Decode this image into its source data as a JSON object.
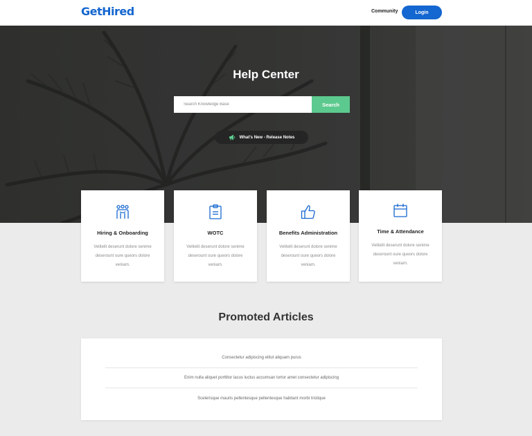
{
  "header": {
    "logo": "GetHired",
    "nav_community": "Community",
    "login_label": "Login"
  },
  "hero": {
    "title": "Help Center",
    "search_placeholder": "Search Knowledge Base",
    "search_button": "Search",
    "release_notes": "What's New - Release Notes",
    "release_icon": "megaphone-icon"
  },
  "categories": [
    {
      "title": "Hiring & Onboarding",
      "description": "Velitelit deserunt dolore senime deserount oure queors dolore veniam.",
      "icon": "team-icon"
    },
    {
      "title": "WOTC",
      "description": "Velitelit deserunt dolore senime deserount oure queors dolore veniam.",
      "icon": "clipboard-icon"
    },
    {
      "title": "Benefits Administration",
      "description": "Velitelit deserunt dolore senime deserount oure queors dolore veniam.",
      "icon": "thumbs-up-icon"
    },
    {
      "title": "Time & Attendance",
      "description": "Velitelit deserunt dolore senime deserount oure queors dolore veniam.",
      "icon": "calendar-icon"
    }
  ],
  "promoted": {
    "title": "Promoted Articles",
    "articles": [
      "Consectetur adipiscing elitut aliquam purus",
      "Enim nulla aliquet porttitor lacus luctus accumsan tortor amet consectetur adipiscing",
      "Scelerisque mauris pellentesque pellentesque habitant morbi tristique"
    ]
  },
  "colors": {
    "brand_blue": "#1466d0",
    "search_green": "#5cc98e",
    "hero_dark": "#3b3c3a",
    "page_bg": "#ebebeb"
  }
}
